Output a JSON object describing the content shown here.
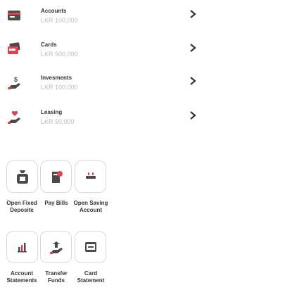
{
  "accounts_list": [
    {
      "title": "Accounts",
      "amount": "LKR 100,000",
      "icon": "bank-card-icon"
    },
    {
      "title": "Cards",
      "amount": "LKR 500,000",
      "icon": "visa-card-icon"
    },
    {
      "title": "Invesments",
      "amount": "LKR 100,000",
      "icon": "investment-hand-icon"
    },
    {
      "title": "Leasing",
      "amount": "LKR 50,000",
      "icon": "leasing-hand-icon"
    }
  ],
  "quick_actions": [
    {
      "line1": "Open Fixed",
      "line2": "Deposite",
      "icon": "bank-bag-icon"
    },
    {
      "line1": "Pay Bills",
      "line2": "",
      "icon": "bill-payment-icon"
    },
    {
      "line1": "Open Saving",
      "line2": "Account",
      "icon": "savings-account-icon"
    },
    {
      "line1": "Account",
      "line2": "Statements",
      "icon": "statement-chart-icon"
    },
    {
      "line1": "Transfer",
      "line2": "Funds",
      "icon": "transfer-funds-icon"
    },
    {
      "line1": "Card",
      "line2": "Statement",
      "icon": "card-statement-icon"
    }
  ],
  "colors": {
    "accent": "#e0434f",
    "dark": "#4a4a4a",
    "muted": "#bbbbbb",
    "border": "#d9d9d9"
  }
}
